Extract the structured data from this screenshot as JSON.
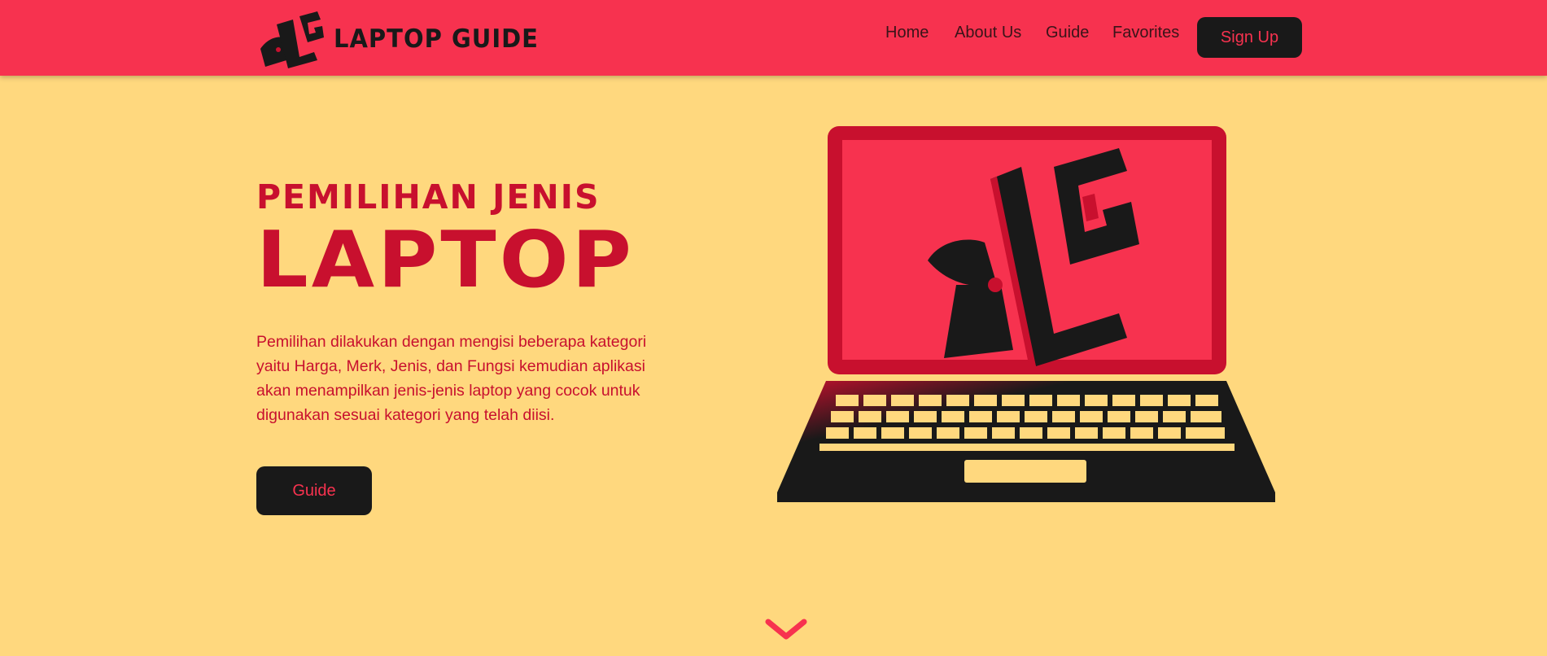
{
  "app": {
    "brand_name": "LAPTOP GUIDE",
    "logo_letters": "LG"
  },
  "nav": {
    "items": [
      {
        "label": "Home"
      },
      {
        "label": "About Us"
      },
      {
        "label": "Guide"
      },
      {
        "label": "Favorites"
      }
    ],
    "signup_label": "Sign Up"
  },
  "hero": {
    "subtitle": "PEMILIHAN JENIS",
    "title": "LAPTOP",
    "description": "Pemilihan dilakukan dengan mengisi beberapa kategori yaitu Harga, Merk, Jenis, dan Fungsi kemudian aplikasi akan menampilkan jenis-jenis laptop yang cocok untuk digunakan sesuai kategori yang telah diisi.",
    "cta_label": "Guide"
  },
  "icons": {
    "logo": "lg-logo-icon",
    "hero_image": "laptop-illustration-icon",
    "scroll": "chevron-down-icon"
  },
  "colors": {
    "navbar": "#f7324f",
    "background": "#ffd87e",
    "accent_text": "#c8102e",
    "dark": "#191919"
  }
}
